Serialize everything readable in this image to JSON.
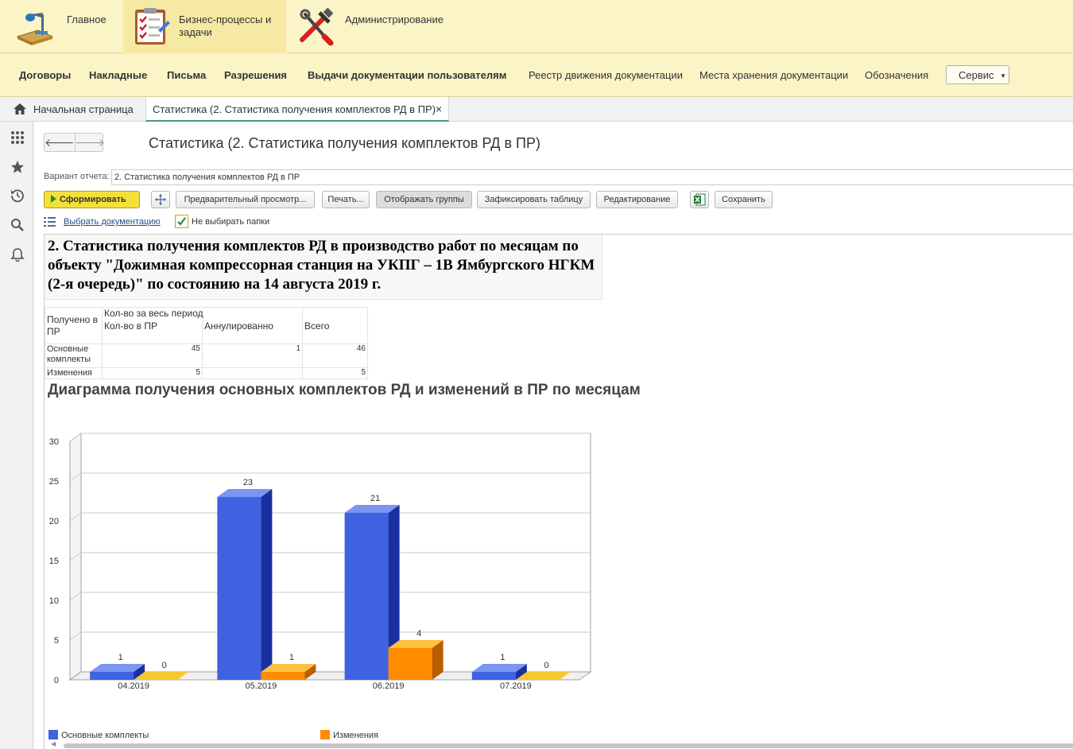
{
  "sections": [
    {
      "label": "Главное",
      "icon": "desk-lamp-icon",
      "active": false
    },
    {
      "label": "Бизнес-процессы и задачи",
      "icon": "checklist-icon",
      "active": true
    },
    {
      "label": "Администрирование",
      "icon": "tools-icon",
      "active": false
    }
  ],
  "nav": {
    "items": [
      {
        "label": "Договоры",
        "bold": true
      },
      {
        "label": "Накладные",
        "bold": true
      },
      {
        "label": "Письма",
        "bold": true
      },
      {
        "label": "Разрешения",
        "bold": true
      },
      {
        "label": "Выдачи документации пользователям",
        "bold": true
      },
      {
        "label": "Реестр движения документации",
        "bold": false
      },
      {
        "label": "Места хранения документации",
        "bold": false
      },
      {
        "label": "Обозначения",
        "bold": false
      }
    ],
    "service_label": "Сервис"
  },
  "tabs": {
    "home": "Начальная страница",
    "active": "Статистика (2. Статистика получения комплектов РД в ПР)",
    "close_glyph": "×"
  },
  "leftbar": [
    "apps-grid-icon",
    "star-icon",
    "history-icon",
    "search-icon",
    "bell-icon"
  ],
  "form": {
    "title": "Статистика (2. Статистика получения комплектов РД в ПР)",
    "back_glyph": "🡐",
    "forward_glyph": "🡒",
    "variant_label": "Вариант отчета:",
    "variant_value": "2. Статистика получения комплектов РД в ПР"
  },
  "toolbar": {
    "generate": "Сформировать",
    "preview": "Предварительный просмотр...",
    "print": "Печать...",
    "show_groups": "Отображать группы",
    "fix_table": "Зафиксировать таблицу",
    "edit": "Редактирование",
    "save": "Сохранить"
  },
  "filters": {
    "select_docs_link": "Выбрать документацию",
    "no_folders_label": "Не выбирать папки",
    "no_folders_checked": true
  },
  "report": {
    "title": "2. Статистика получения комплектов РД в производство работ по месяцам по объекту \"Дожимная компрессорная станция на УКПГ – 1В Ямбургского НГКМ (2-я очередь)\" по состоянию на 14 августа 2019 г.",
    "table": {
      "row_header": "Получено в ПР",
      "group_header": "Кол-во за весь период",
      "col_received": "Кол-во в ПР",
      "col_cancelled": "Аннулированно",
      "col_total": "Всего",
      "rows": [
        {
          "label": "Основные комплекты",
          "received": "45",
          "cancelled": "1",
          "total": "46"
        },
        {
          "label": "Изменения",
          "received": "5",
          "cancelled": "",
          "total": "5"
        }
      ]
    }
  },
  "chart_data": {
    "type": "bar",
    "title": "Диаграмма получения основных комплектов РД и изменений в ПР по месяцам",
    "categories": [
      "04.2019",
      "05.2019",
      "06.2019",
      "07.2019"
    ],
    "series": [
      {
        "name": "Основные комплекты",
        "values": [
          1,
          23,
          21,
          1
        ],
        "color": "#3f62e0"
      },
      {
        "name": "Изменения",
        "values": [
          0,
          1,
          4,
          0
        ],
        "color": "#ff8c00"
      }
    ],
    "yticks": [
      0,
      5,
      10,
      15,
      20,
      25,
      30
    ],
    "ylim": [
      0,
      30
    ],
    "grid": true,
    "legend": "bottom",
    "three_d": true
  }
}
